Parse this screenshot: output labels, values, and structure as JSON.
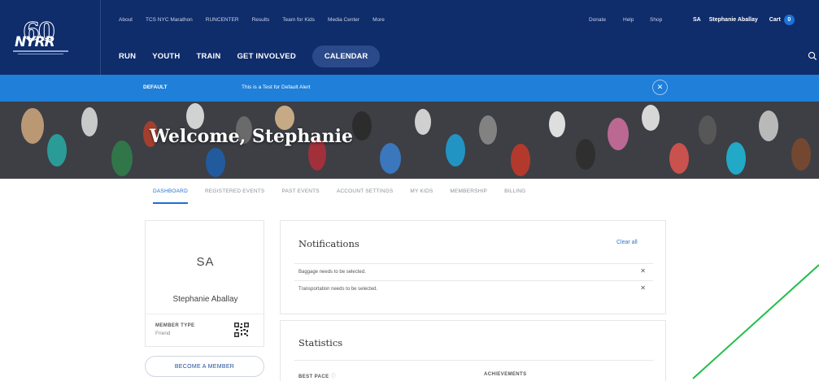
{
  "header": {
    "logo_text": "NYRR",
    "logo_anniversary": "60",
    "top_links": [
      "About",
      "TCS NYC Marathon",
      "RUNCENTER",
      "Results",
      "Team for Kids",
      "Media Center",
      "More"
    ],
    "right_links": [
      "Donate",
      "Help",
      "Shop"
    ],
    "user_initials": "SA",
    "user_name": "Stephanie Aballay",
    "cart_label": "Cart",
    "cart_count": "0",
    "main_nav": [
      "RUN",
      "YOUTH",
      "TRAIN",
      "GET INVOLVED"
    ],
    "calendar_label": "CALENDAR",
    "colors": {
      "header_bg": "#0f2c6b",
      "accent": "#1f7fd9"
    }
  },
  "alert": {
    "label": "DEFAULT",
    "message": "This is a Test for Default Alert",
    "close_icon": "close-icon"
  },
  "hero": {
    "welcome": "Welcome, Stephanie"
  },
  "tabs": {
    "items": [
      "DASHBOARD",
      "REGISTERED EVENTS",
      "PAST EVENTS",
      "ACCOUNT SETTINGS",
      "MY KIDS",
      "MEMBERSHIP",
      "BILLING"
    ],
    "active": "DASHBOARD"
  },
  "profile": {
    "initials": "SA",
    "name": "Stephanie Aballay",
    "member_type_label": "MEMBER TYPE",
    "member_type_value": "Friend",
    "become_member": "BECOME A MEMBER"
  },
  "notifications": {
    "title": "Notifications",
    "clear_all": "Clear all",
    "items": [
      "Baggage needs to be selected.",
      "Transportation needs to be selected."
    ]
  },
  "statistics": {
    "title": "Statistics",
    "best_pace": "BEST PACE",
    "achievements": "ACHIEVEMENTS"
  }
}
